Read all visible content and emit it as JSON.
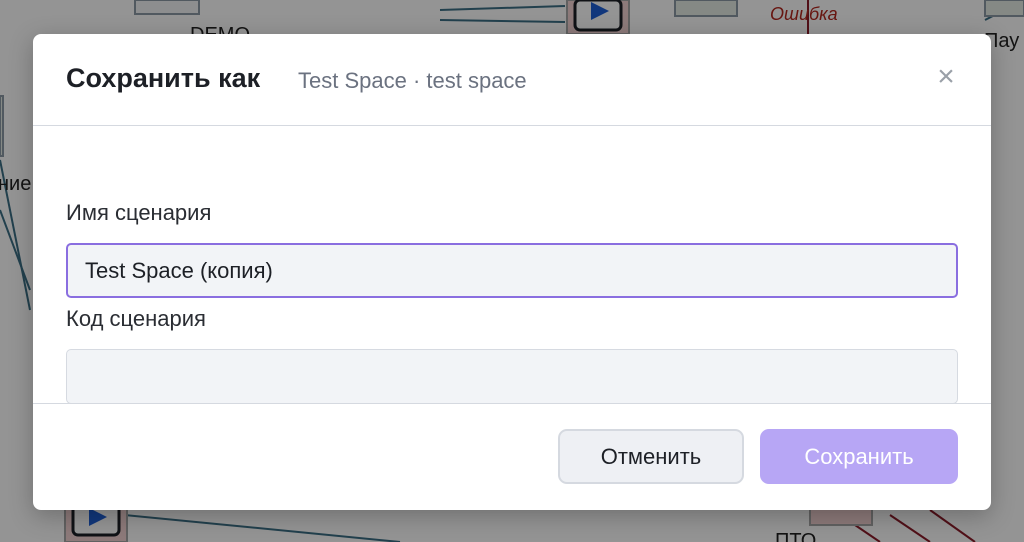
{
  "background": {
    "node_labels": [
      "ние",
      "Пау",
      "ПТО"
    ],
    "edge_label": "Ошибка",
    "partial_text_top": "DEMO"
  },
  "modal": {
    "title": "Сохранить как",
    "subtitle": "Test Space · test space",
    "close_symbol": "×",
    "fields": {
      "name": {
        "label": "Имя сценария",
        "value": "Test Space (копия)",
        "placeholder": ""
      },
      "code": {
        "label": "Код сценария",
        "value": "",
        "placeholder": ""
      }
    },
    "buttons": {
      "cancel": "Отменить",
      "save": "Сохранить"
    }
  },
  "colors": {
    "accent_focus": "#8a6ee0",
    "save_button_disabled": "#b7a6f5",
    "error_label": "#b3261e",
    "play_icon": "#1e5fd6"
  }
}
